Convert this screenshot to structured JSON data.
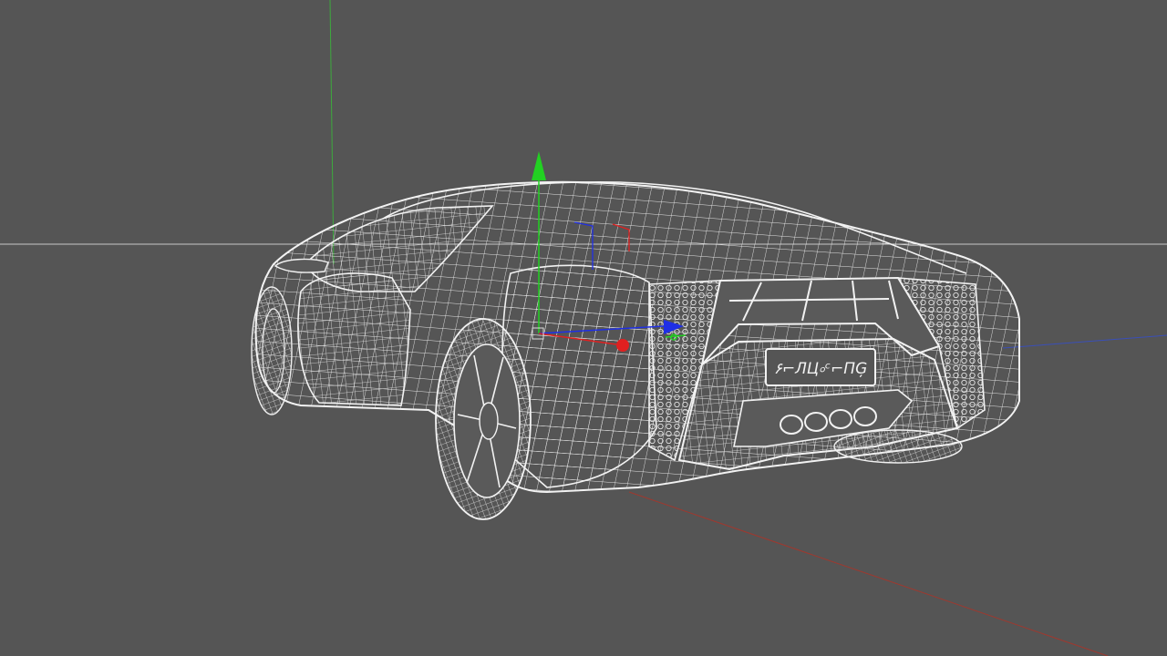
{
  "viewport": {
    "background": "#555555",
    "wire_color": "#ECECEC"
  },
  "grid_axes": {
    "x_axis_color": "#A0382E",
    "y_axis_color": "#3DAA3D",
    "z_axis_color": "#3A4FB8",
    "horizon_color": "#C8C8C8"
  },
  "gizmo": {
    "x_color": "#E02020",
    "y_color": "#22D122",
    "z_color": "#1F2FE6"
  },
  "model": {
    "name": "sports-car-wireframe",
    "plate_text": "۶⌐ЛЦ৹ᶜ⌐ΠĢ"
  }
}
